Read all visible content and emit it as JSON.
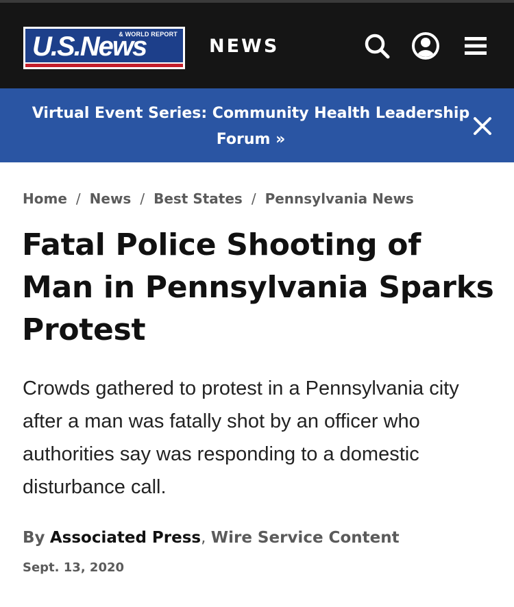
{
  "header": {
    "logo_main": "U.S.News",
    "logo_sub": "& WORLD REPORT",
    "section_label": "NEWS",
    "icons": [
      "search-icon",
      "account-icon",
      "menu-icon"
    ]
  },
  "banner": {
    "line1": "Virtual Event Series: Community Health Leadership",
    "line2": "Forum »",
    "close_icon": "close-icon"
  },
  "breadcrumb": [
    "Home",
    "News",
    "Best States",
    "Pennsylvania News"
  ],
  "breadcrumb_separator": "/",
  "article": {
    "headline": "Fatal Police Shooting of Man in Pennsylvania Sparks Protest",
    "summary": "Crowds gathered to protest in a Pennsylvania city after a man was fatally shot by an officer who authorities say was responding to a domestic disturbance call.",
    "byline_prefix": "By",
    "author": "Associated Press",
    "byline_separator": ",",
    "content_type": "Wire Service Content",
    "date": "Sept. 13, 2020"
  },
  "colors": {
    "header_bg": "#151515",
    "banner_bg": "#2a55a3",
    "logo_blue": "#1d3f8a",
    "logo_red": "#c41e2a"
  }
}
